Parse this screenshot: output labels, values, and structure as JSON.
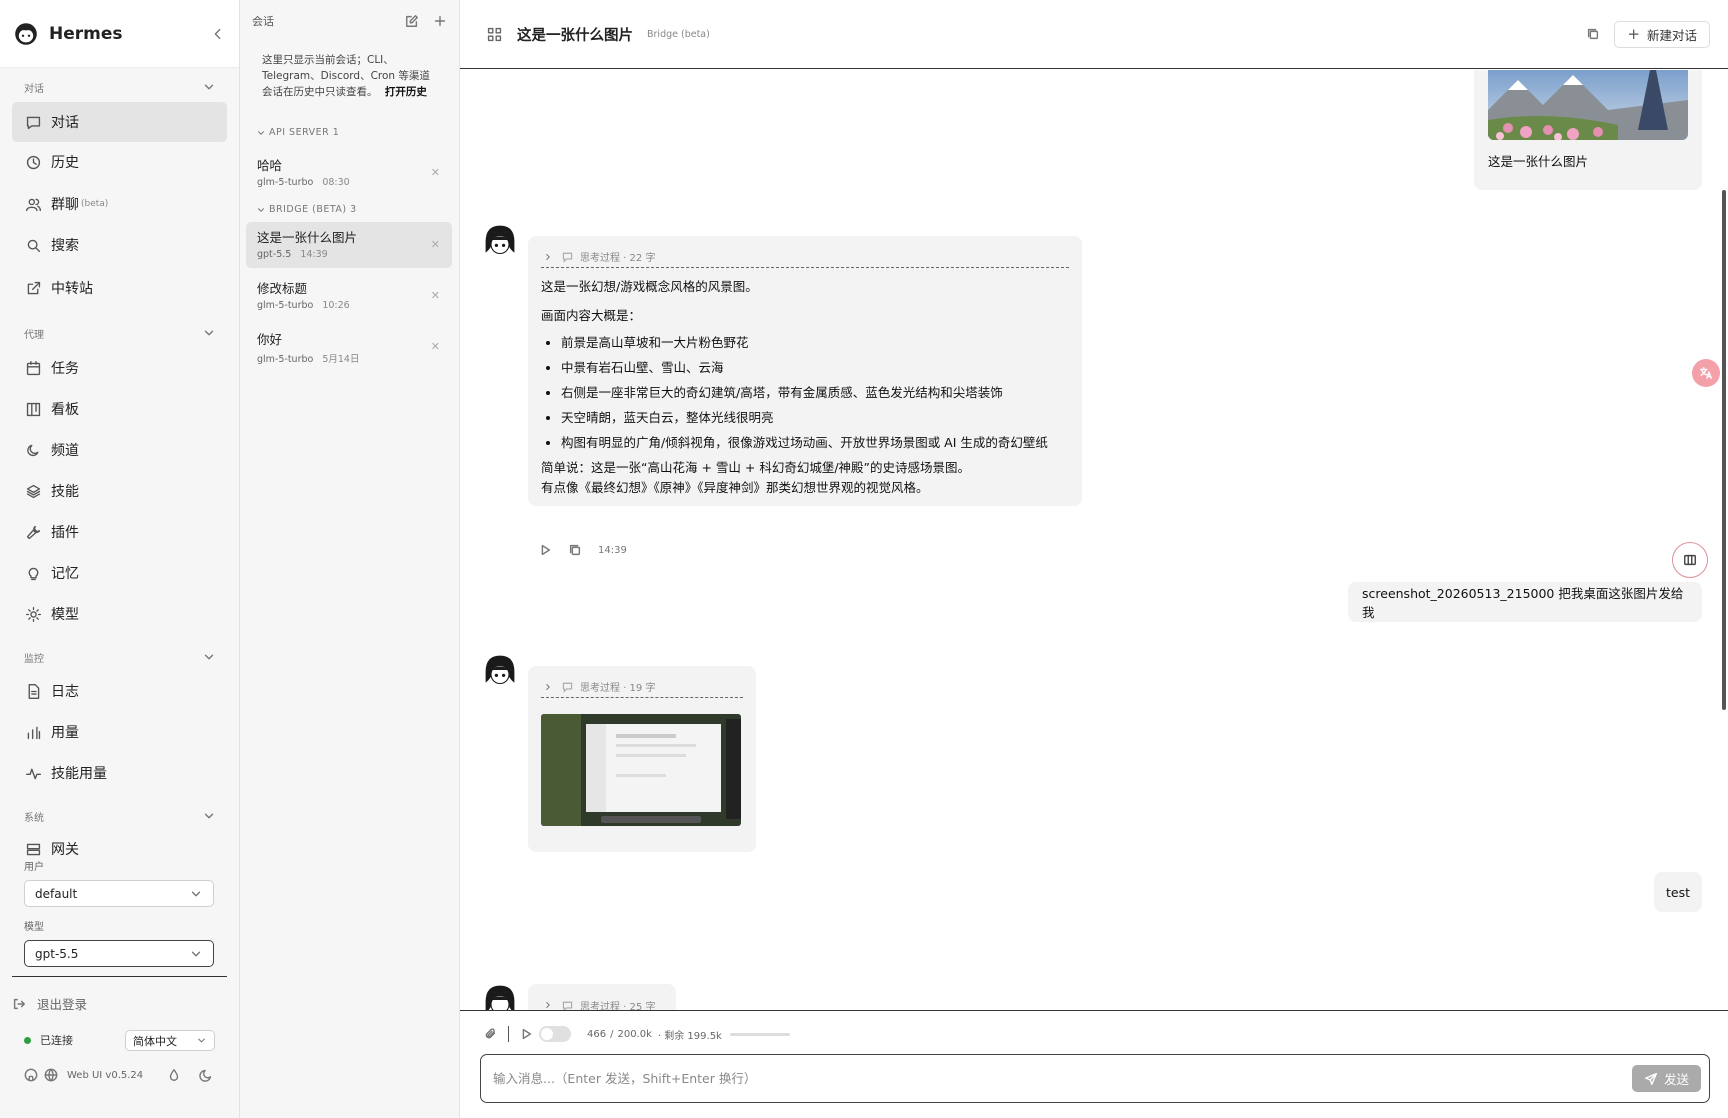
{
  "app": {
    "name": "Hermes"
  },
  "sidebar": {
    "sections": [
      {
        "label": "对话"
      },
      {
        "label": "代理"
      },
      {
        "label": "监控"
      },
      {
        "label": "系统"
      }
    ],
    "items": [
      {
        "label": "对话"
      },
      {
        "label": "历史"
      },
      {
        "label": "群聊",
        "badge": "(beta)"
      },
      {
        "label": "搜索"
      },
      {
        "label": "中转站"
      },
      {
        "label": "任务"
      },
      {
        "label": "看板"
      },
      {
        "label": "频道"
      },
      {
        "label": "技能"
      },
      {
        "label": "插件"
      },
      {
        "label": "记忆"
      },
      {
        "label": "模型"
      },
      {
        "label": "日志"
      },
      {
        "label": "用量"
      },
      {
        "label": "技能用量"
      },
      {
        "label": "网关"
      }
    ],
    "user_label": "用户",
    "user_value": "default",
    "model_label": "模型",
    "model_value": "gpt-5.5",
    "logout": "退出登录",
    "status": "已连接",
    "language": "简体中文",
    "version": "Web UI v0.5.24",
    "status_color": "#2e9e3f"
  },
  "sessions": {
    "header": "会话",
    "note_prefix": "这里只显示当前会话；CLI、Telegram、Discord、Cron 等渠道会话在历史中只读查看。",
    "note_link": "打开历史",
    "groups": [
      {
        "label": "API SERVER 1"
      },
      {
        "label": "BRIDGE (BETA) 3"
      }
    ],
    "items": [
      {
        "title": "哈哈",
        "model": "glm-5-turbo",
        "time": "08:30"
      },
      {
        "title": "这是一张什么图片",
        "model": "gpt-5.5",
        "time": "14:39"
      },
      {
        "title": "修改标题",
        "model": "glm-5-turbo",
        "time": "10:26"
      },
      {
        "title": "你好",
        "model": "glm-5-turbo",
        "time": "5月14日"
      }
    ]
  },
  "chat": {
    "title": "这是一张什么图片",
    "subtitle": "Bridge (beta)",
    "new_chat": "新建对话",
    "messages": {
      "user1_caption": "这是一张什么图片",
      "a1_think": "思考过程 · 22 字",
      "a1_intro": "这是一张幻想/游戏概念风格的风景图。",
      "a1_lead": "画面内容大概是：",
      "a1_points": [
        "前景是高山草坡和一大片粉色野花",
        "中景有岩石山壁、雪山、云海",
        "右侧是一座非常巨大的奇幻建筑/高塔，带有金属质感、蓝色发光结构和尖塔装饰",
        "天空晴朗，蓝天白云，整体光线很明亮",
        "构图有明显的广角/倾斜视角，很像游戏过场动画、开放世界场景图或 AI 生成的奇幻壁纸"
      ],
      "a1_sum1": "简单说：这是一张“高山花海 + 雪山 + 科幻奇幻城堡/神殿”的史诗感场景图。",
      "a1_sum2": "有点像《最终幻想》《原神》《异度神剑》那类幻想世界观的视觉风格。",
      "a1_time": "14:39",
      "user2": "screenshot_20260513_215000 把我桌面这张图片发给我",
      "a2_think": "思考过程 · 19 字",
      "user3": "test",
      "a3_think": "思考过程 · 25 字"
    }
  },
  "composer": {
    "tokens_used": "466",
    "tokens_sep": "/",
    "tokens_total": "200.0k",
    "remaining": "· 剩余 199.5k",
    "placeholder": "输入消息...（Enter 发送，Shift+Enter 换行）",
    "send": "发送"
  }
}
